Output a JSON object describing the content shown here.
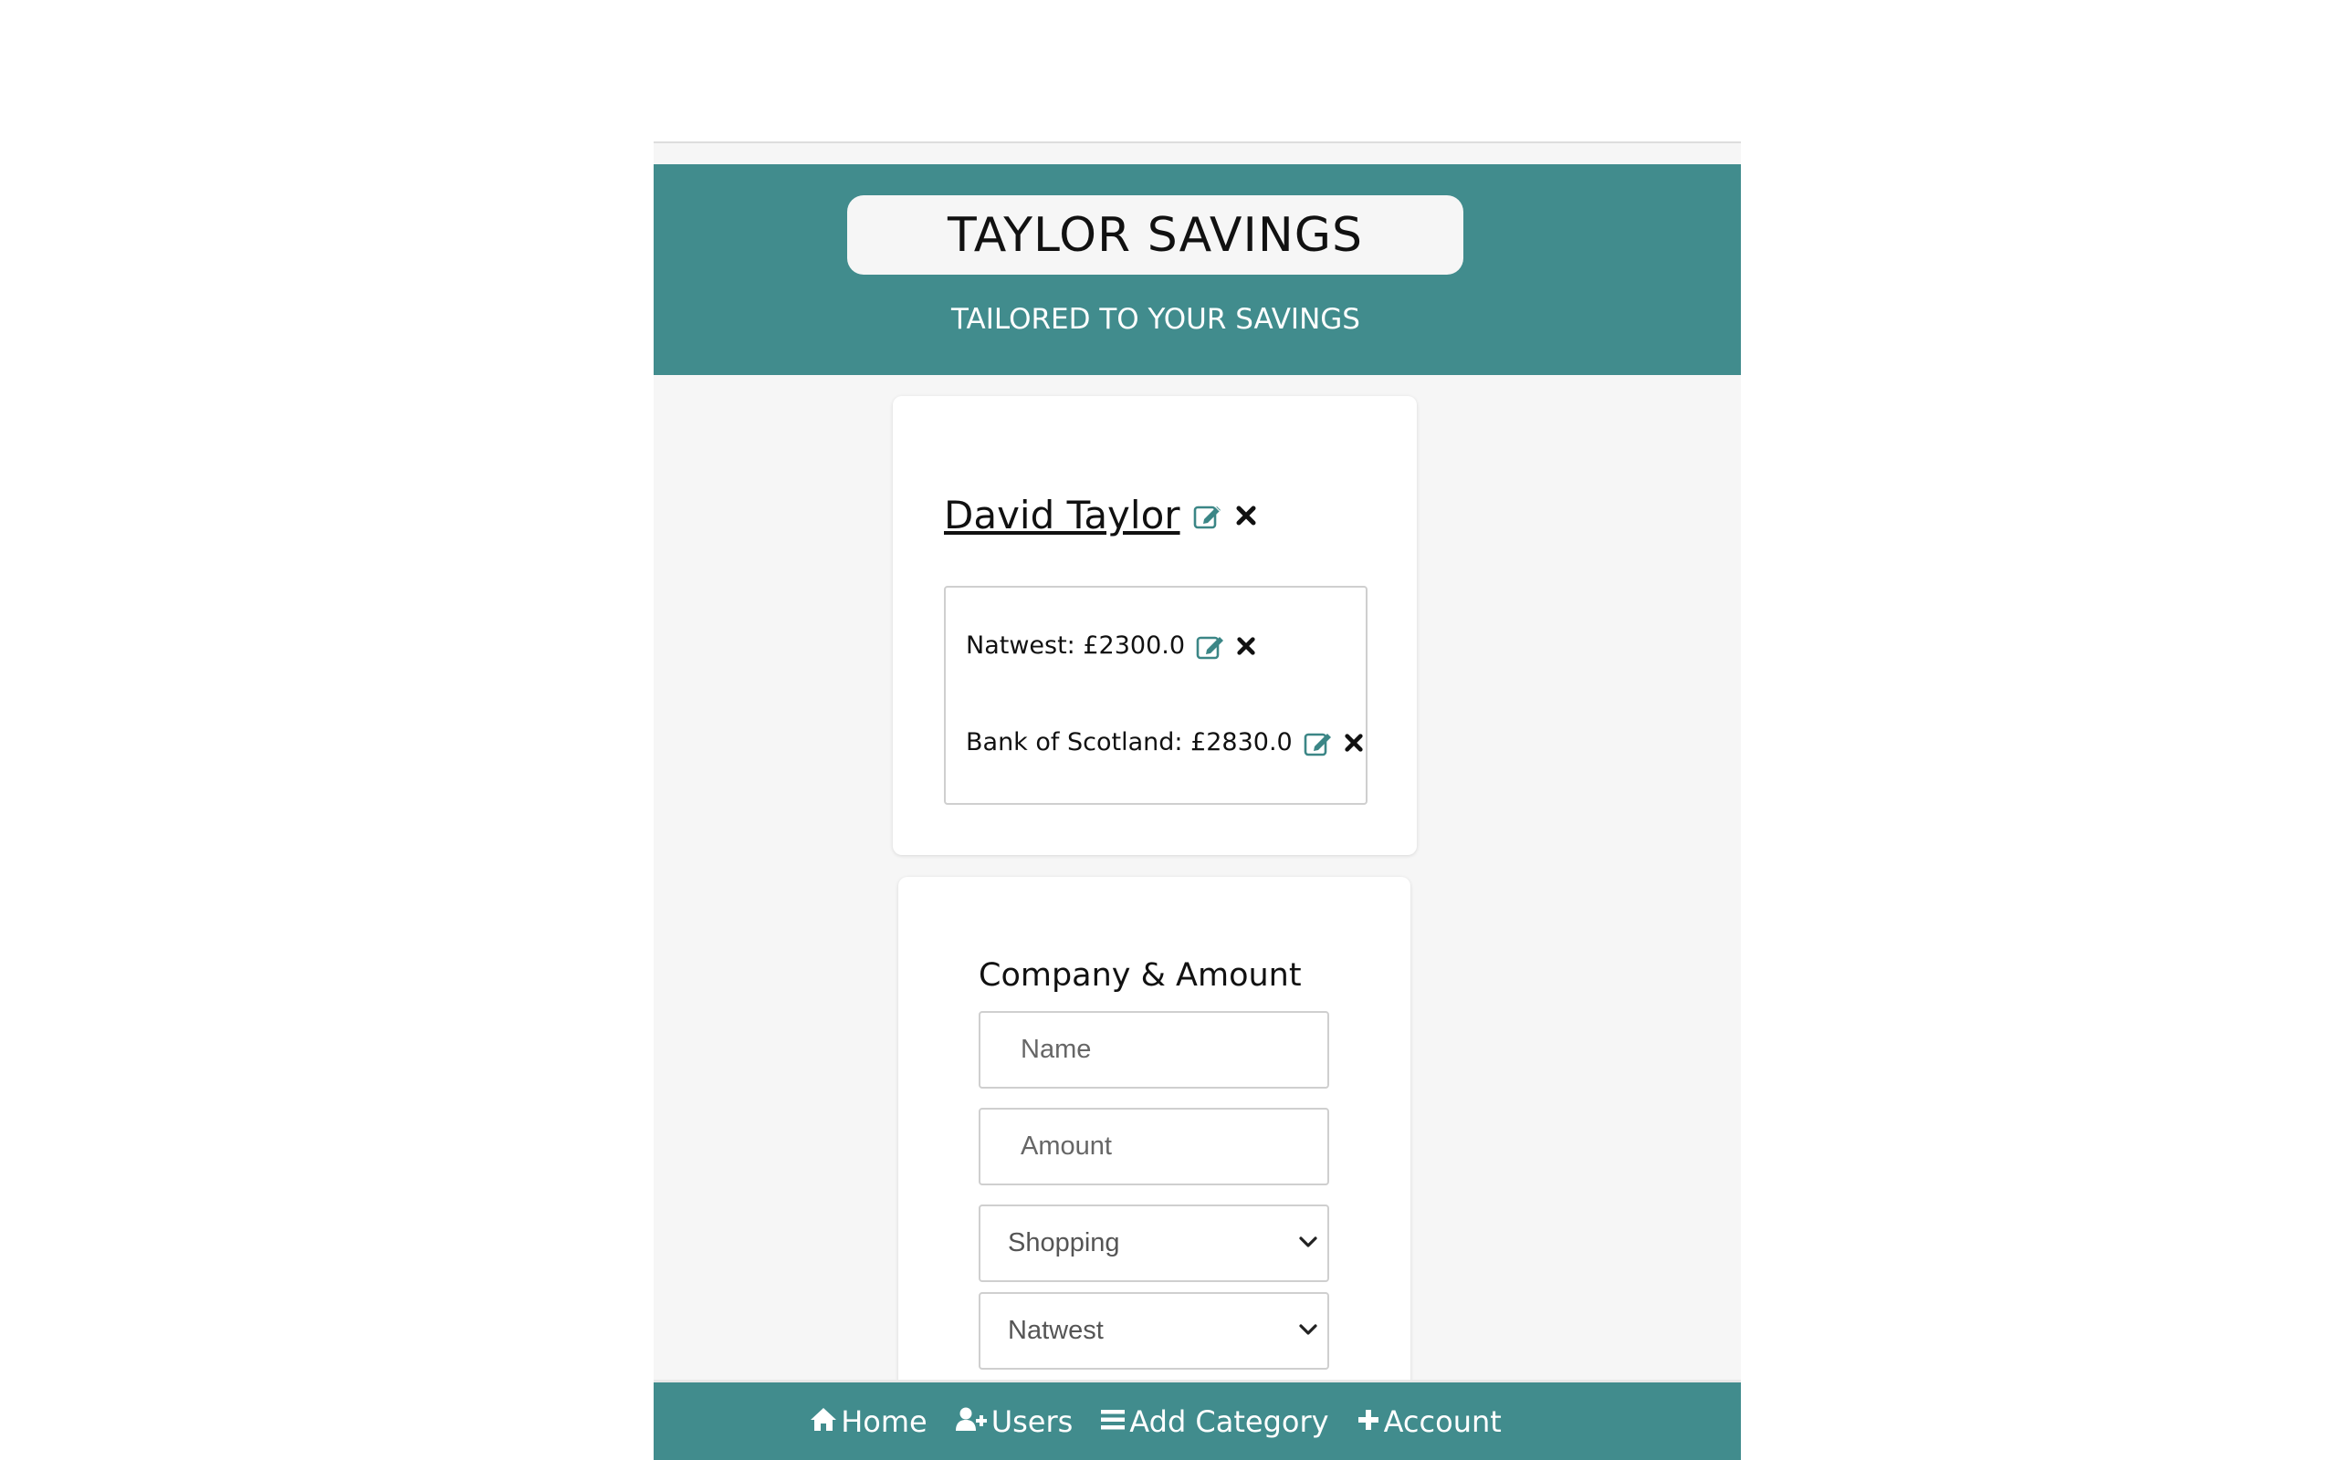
{
  "header": {
    "title": "TAYLOR SAVINGS",
    "tagline": "TAILORED TO YOUR SAVINGS"
  },
  "user": {
    "name": "David Taylor",
    "accounts": [
      {
        "label": "Natwest: £2300.0"
      },
      {
        "label": "Bank of Scotland: £2830.0"
      }
    ]
  },
  "form": {
    "heading": "Company & Amount",
    "name_placeholder": "Name",
    "amount_placeholder": "Amount",
    "category_selected": "Shopping",
    "company_selected": "Natwest"
  },
  "nav": {
    "items": [
      {
        "label": "Home",
        "icon": "home-icon"
      },
      {
        "label": "Users",
        "icon": "user-plus-icon"
      },
      {
        "label": "Add Category",
        "icon": "bars-icon"
      },
      {
        "label": "Account",
        "icon": "plus-icon"
      }
    ]
  },
  "colors": {
    "accent": "#418c8d",
    "background": "#f6f6f6",
    "edit_icon": "#3b8686"
  }
}
